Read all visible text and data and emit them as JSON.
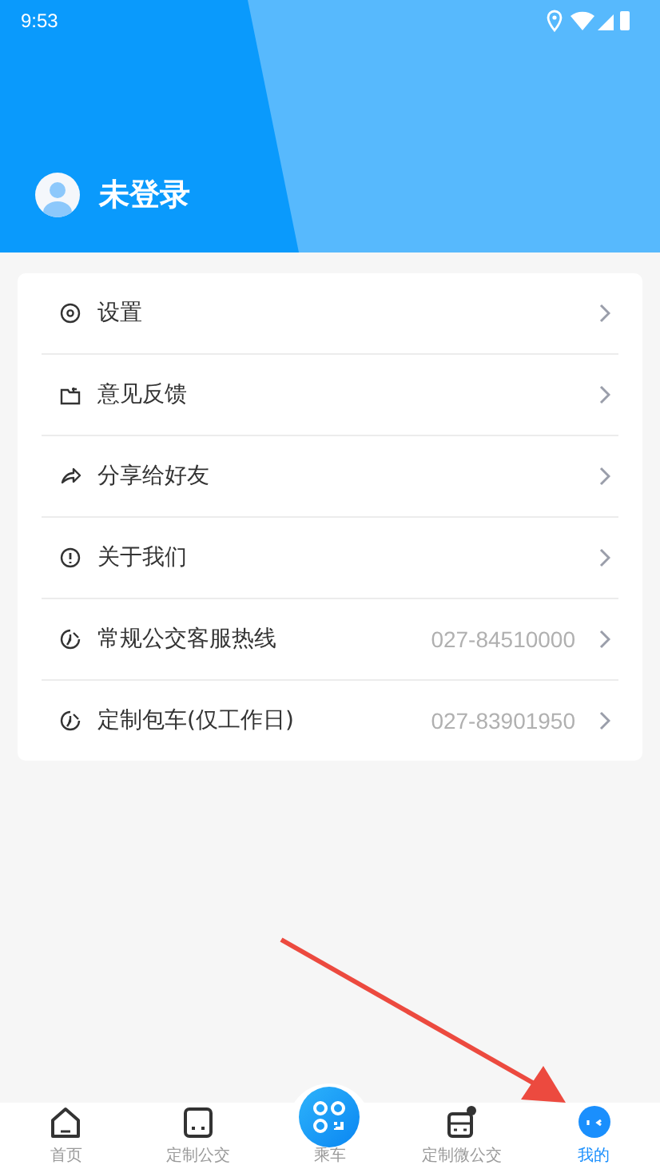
{
  "status_bar": {
    "time": "9:53"
  },
  "profile": {
    "name": "未登录"
  },
  "menu": [
    {
      "kind": "settings",
      "label": "设置"
    },
    {
      "kind": "feedback",
      "label": "意见反馈"
    },
    {
      "kind": "share",
      "label": "分享给好友"
    },
    {
      "kind": "about",
      "label": "关于我们"
    },
    {
      "kind": "hotline",
      "label": "常规公交客服热线",
      "value": "027-84510000"
    },
    {
      "kind": "hotline",
      "label": "定制包车(仅工作日)",
      "value": "027-83901950"
    }
  ],
  "tabs": [
    {
      "kind": "home",
      "label": "首页",
      "selected": false
    },
    {
      "kind": "custom",
      "label": "定制公交",
      "selected": false
    },
    {
      "kind": "ride",
      "label": "乘车",
      "selected": false
    },
    {
      "kind": "micro",
      "label": "定制微公交",
      "selected": false
    },
    {
      "kind": "mine",
      "label": "我的",
      "selected": true
    }
  ]
}
